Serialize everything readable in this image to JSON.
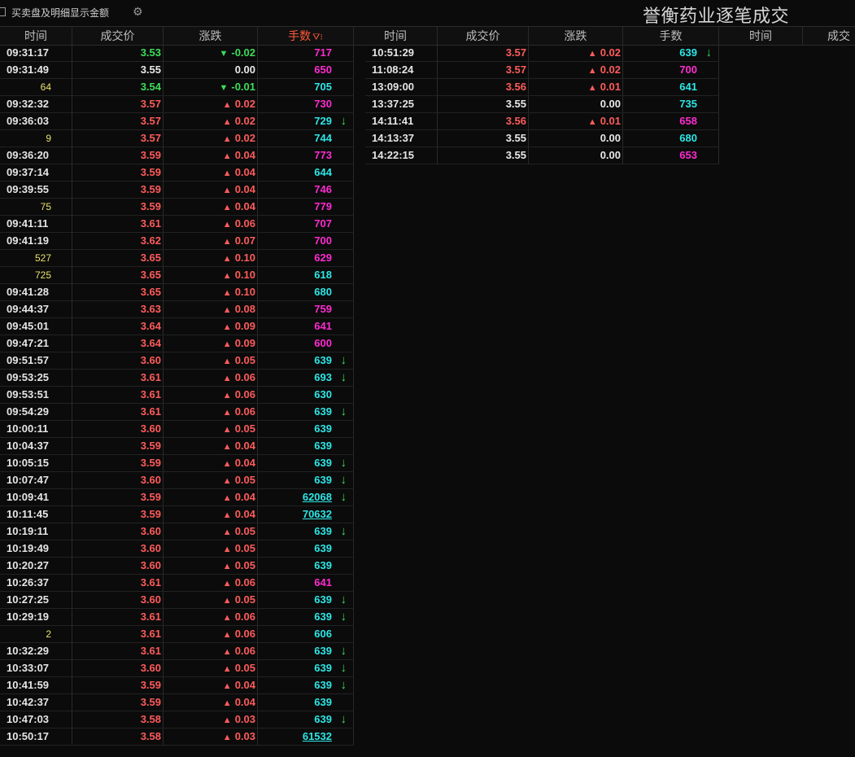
{
  "toolbar": {
    "checkbox_label": "买卖盘及明细显示金额",
    "settings_icon": "gear-icon"
  },
  "title": "誉衡药业逐笔成交",
  "colors": {
    "up": "#ff5b5b",
    "down": "#3ddc5a",
    "cyan": "#2ee6e6",
    "magenta": "#ff2bd1",
    "active_header": "#ff5a3c"
  },
  "headers": {
    "g1": {
      "time": "时间",
      "price": "成交价",
      "change": "涨跌",
      "volume": "手数"
    },
    "g2": {
      "time": "时间",
      "price": "成交价",
      "change": "涨跌",
      "volume": "手数"
    },
    "g3": {
      "time": "时间",
      "price": "成交"
    }
  },
  "icons": {
    "filter": "filter-icon",
    "up_arrow": "up-triangle-icon",
    "down_arrow": "down-triangle-icon",
    "big_order": "down-arrow-icon"
  },
  "rows_left": [
    {
      "time": "09:31:17",
      "price": "3.53",
      "pc": "green",
      "dir": "down",
      "chg": "-0.02",
      "vol": "717",
      "vc": "magenta",
      "ind": false
    },
    {
      "time": "09:31:49",
      "price": "3.55",
      "pc": "white",
      "dir": "none",
      "chg": "0.00",
      "vol": "650",
      "vc": "magenta",
      "ind": false
    },
    {
      "time": "64",
      "partial": true,
      "price": "3.54",
      "pc": "green",
      "dir": "down",
      "chg": "-0.01",
      "vol": "705",
      "vc": "cyan",
      "ind": false
    },
    {
      "time": "09:32:32",
      "price": "3.57",
      "pc": "red",
      "dir": "up",
      "chg": "0.02",
      "vol": "730",
      "vc": "magenta",
      "ind": false
    },
    {
      "time": "09:36:03",
      "price": "3.57",
      "pc": "red",
      "dir": "up",
      "chg": "0.02",
      "vol": "729",
      "vc": "cyan",
      "ind": true
    },
    {
      "time": "9",
      "partial": true,
      "price": "3.57",
      "pc": "red",
      "dir": "up",
      "chg": "0.02",
      "vol": "744",
      "vc": "cyan",
      "ind": false
    },
    {
      "time": "09:36:20",
      "price": "3.59",
      "pc": "red",
      "dir": "up",
      "chg": "0.04",
      "vol": "773",
      "vc": "magenta",
      "ind": false
    },
    {
      "time": "09:37:14",
      "price": "3.59",
      "pc": "red",
      "dir": "up",
      "chg": "0.04",
      "vol": "644",
      "vc": "cyan",
      "ind": false
    },
    {
      "time": "09:39:55",
      "price": "3.59",
      "pc": "red",
      "dir": "up",
      "chg": "0.04",
      "vol": "746",
      "vc": "magenta",
      "ind": false
    },
    {
      "time": "75",
      "partial": true,
      "price": "3.59",
      "pc": "red",
      "dir": "up",
      "chg": "0.04",
      "vol": "779",
      "vc": "magenta",
      "ind": false
    },
    {
      "time": "09:41:11",
      "price": "3.61",
      "pc": "red",
      "dir": "up",
      "chg": "0.06",
      "vol": "707",
      "vc": "magenta",
      "ind": false
    },
    {
      "time": "09:41:19",
      "price": "3.62",
      "pc": "red",
      "dir": "up",
      "chg": "0.07",
      "vol": "700",
      "vc": "magenta",
      "ind": false
    },
    {
      "time": "527",
      "partial": true,
      "price": "3.65",
      "pc": "red",
      "dir": "up",
      "chg": "0.10",
      "vol": "629",
      "vc": "magenta",
      "ind": false
    },
    {
      "time": "725",
      "partial": true,
      "price": "3.65",
      "pc": "red",
      "dir": "up",
      "chg": "0.10",
      "vol": "618",
      "vc": "cyan",
      "ind": false
    },
    {
      "time": "09:41:28",
      "price": "3.65",
      "pc": "red",
      "dir": "up",
      "chg": "0.10",
      "vol": "680",
      "vc": "cyan",
      "ind": false
    },
    {
      "time": "09:44:37",
      "price": "3.63",
      "pc": "red",
      "dir": "up",
      "chg": "0.08",
      "vol": "759",
      "vc": "magenta",
      "ind": false
    },
    {
      "time": "09:45:01",
      "price": "3.64",
      "pc": "red",
      "dir": "up",
      "chg": "0.09",
      "vol": "641",
      "vc": "magenta",
      "ind": false
    },
    {
      "time": "09:47:21",
      "price": "3.64",
      "pc": "red",
      "dir": "up",
      "chg": "0.09",
      "vol": "600",
      "vc": "magenta",
      "ind": false
    },
    {
      "time": "09:51:57",
      "price": "3.60",
      "pc": "red",
      "dir": "up",
      "chg": "0.05",
      "vol": "639",
      "vc": "cyan",
      "ind": true
    },
    {
      "time": "09:53:25",
      "price": "3.61",
      "pc": "red",
      "dir": "up",
      "chg": "0.06",
      "vol": "693",
      "vc": "cyan",
      "ind": true
    },
    {
      "time": "09:53:51",
      "price": "3.61",
      "pc": "red",
      "dir": "up",
      "chg": "0.06",
      "vol": "630",
      "vc": "cyan",
      "ind": false
    },
    {
      "time": "09:54:29",
      "price": "3.61",
      "pc": "red",
      "dir": "up",
      "chg": "0.06",
      "vol": "639",
      "vc": "cyan",
      "ind": true
    },
    {
      "time": "10:00:11",
      "price": "3.60",
      "pc": "red",
      "dir": "up",
      "chg": "0.05",
      "vol": "639",
      "vc": "cyan",
      "ind": false
    },
    {
      "time": "10:04:37",
      "price": "3.59",
      "pc": "red",
      "dir": "up",
      "chg": "0.04",
      "vol": "639",
      "vc": "cyan",
      "ind": false
    },
    {
      "time": "10:05:15",
      "price": "3.59",
      "pc": "red",
      "dir": "up",
      "chg": "0.04",
      "vol": "639",
      "vc": "cyan",
      "ind": true
    },
    {
      "time": "10:07:47",
      "price": "3.60",
      "pc": "red",
      "dir": "up",
      "chg": "0.05",
      "vol": "639",
      "vc": "cyan",
      "ind": true
    },
    {
      "time": "10:09:41",
      "price": "3.59",
      "pc": "red",
      "dir": "up",
      "chg": "0.04",
      "vol": "62068",
      "vc": "cyan",
      "ind": true,
      "under": true
    },
    {
      "time": "10:11:45",
      "price": "3.59",
      "pc": "red",
      "dir": "up",
      "chg": "0.04",
      "vol": "70632",
      "vc": "cyan",
      "ind": false,
      "under": true
    },
    {
      "time": "10:19:11",
      "price": "3.60",
      "pc": "red",
      "dir": "up",
      "chg": "0.05",
      "vol": "639",
      "vc": "cyan",
      "ind": true
    },
    {
      "time": "10:19:49",
      "price": "3.60",
      "pc": "red",
      "dir": "up",
      "chg": "0.05",
      "vol": "639",
      "vc": "cyan",
      "ind": false
    },
    {
      "time": "10:20:27",
      "price": "3.60",
      "pc": "red",
      "dir": "up",
      "chg": "0.05",
      "vol": "639",
      "vc": "cyan",
      "ind": false
    },
    {
      "time": "10:26:37",
      "price": "3.61",
      "pc": "red",
      "dir": "up",
      "chg": "0.06",
      "vol": "641",
      "vc": "magenta",
      "ind": false
    },
    {
      "time": "10:27:25",
      "price": "3.60",
      "pc": "red",
      "dir": "up",
      "chg": "0.05",
      "vol": "639",
      "vc": "cyan",
      "ind": true
    },
    {
      "time": "10:29:19",
      "price": "3.61",
      "pc": "red",
      "dir": "up",
      "chg": "0.06",
      "vol": "639",
      "vc": "cyan",
      "ind": true
    },
    {
      "time": "2",
      "partial": true,
      "price": "3.61",
      "pc": "red",
      "dir": "up",
      "chg": "0.06",
      "vol": "606",
      "vc": "cyan",
      "ind": false
    },
    {
      "time": "10:32:29",
      "price": "3.61",
      "pc": "red",
      "dir": "up",
      "chg": "0.06",
      "vol": "639",
      "vc": "cyan",
      "ind": true
    },
    {
      "time": "10:33:07",
      "price": "3.60",
      "pc": "red",
      "dir": "up",
      "chg": "0.05",
      "vol": "639",
      "vc": "cyan",
      "ind": true
    },
    {
      "time": "10:41:59",
      "price": "3.59",
      "pc": "red",
      "dir": "up",
      "chg": "0.04",
      "vol": "639",
      "vc": "cyan",
      "ind": true
    },
    {
      "time": "10:42:37",
      "price": "3.59",
      "pc": "red",
      "dir": "up",
      "chg": "0.04",
      "vol": "639",
      "vc": "cyan",
      "ind": false
    },
    {
      "time": "10:47:03",
      "price": "3.58",
      "pc": "red",
      "dir": "up",
      "chg": "0.03",
      "vol": "639",
      "vc": "cyan",
      "ind": true
    },
    {
      "time": "10:50:17",
      "price": "3.58",
      "pc": "red",
      "dir": "up",
      "chg": "0.03",
      "vol": "61532",
      "vc": "cyan",
      "ind": false,
      "under": true
    }
  ],
  "rows_right": [
    {
      "time": "10:51:29",
      "price": "3.57",
      "pc": "red",
      "dir": "up",
      "chg": "0.02",
      "vol": "639",
      "vc": "cyan",
      "ind": true
    },
    {
      "time": "11:08:24",
      "price": "3.57",
      "pc": "red",
      "dir": "up",
      "chg": "0.02",
      "vol": "700",
      "vc": "magenta",
      "ind": false
    },
    {
      "time": "13:09:00",
      "price": "3.56",
      "pc": "red",
      "dir": "up",
      "chg": "0.01",
      "vol": "641",
      "vc": "cyan",
      "ind": false
    },
    {
      "time": "13:37:25",
      "price": "3.55",
      "pc": "white",
      "dir": "none",
      "chg": "0.00",
      "vol": "735",
      "vc": "cyan",
      "ind": false
    },
    {
      "time": "14:11:41",
      "price": "3.56",
      "pc": "red",
      "dir": "up",
      "chg": "0.01",
      "vol": "658",
      "vc": "magenta",
      "ind": false
    },
    {
      "time": "14:13:37",
      "price": "3.55",
      "pc": "white",
      "dir": "none",
      "chg": "0.00",
      "vol": "680",
      "vc": "cyan",
      "ind": false
    },
    {
      "time": "14:22:15",
      "price": "3.55",
      "pc": "white",
      "dir": "none",
      "chg": "0.00",
      "vol": "653",
      "vc": "magenta",
      "ind": false
    }
  ]
}
